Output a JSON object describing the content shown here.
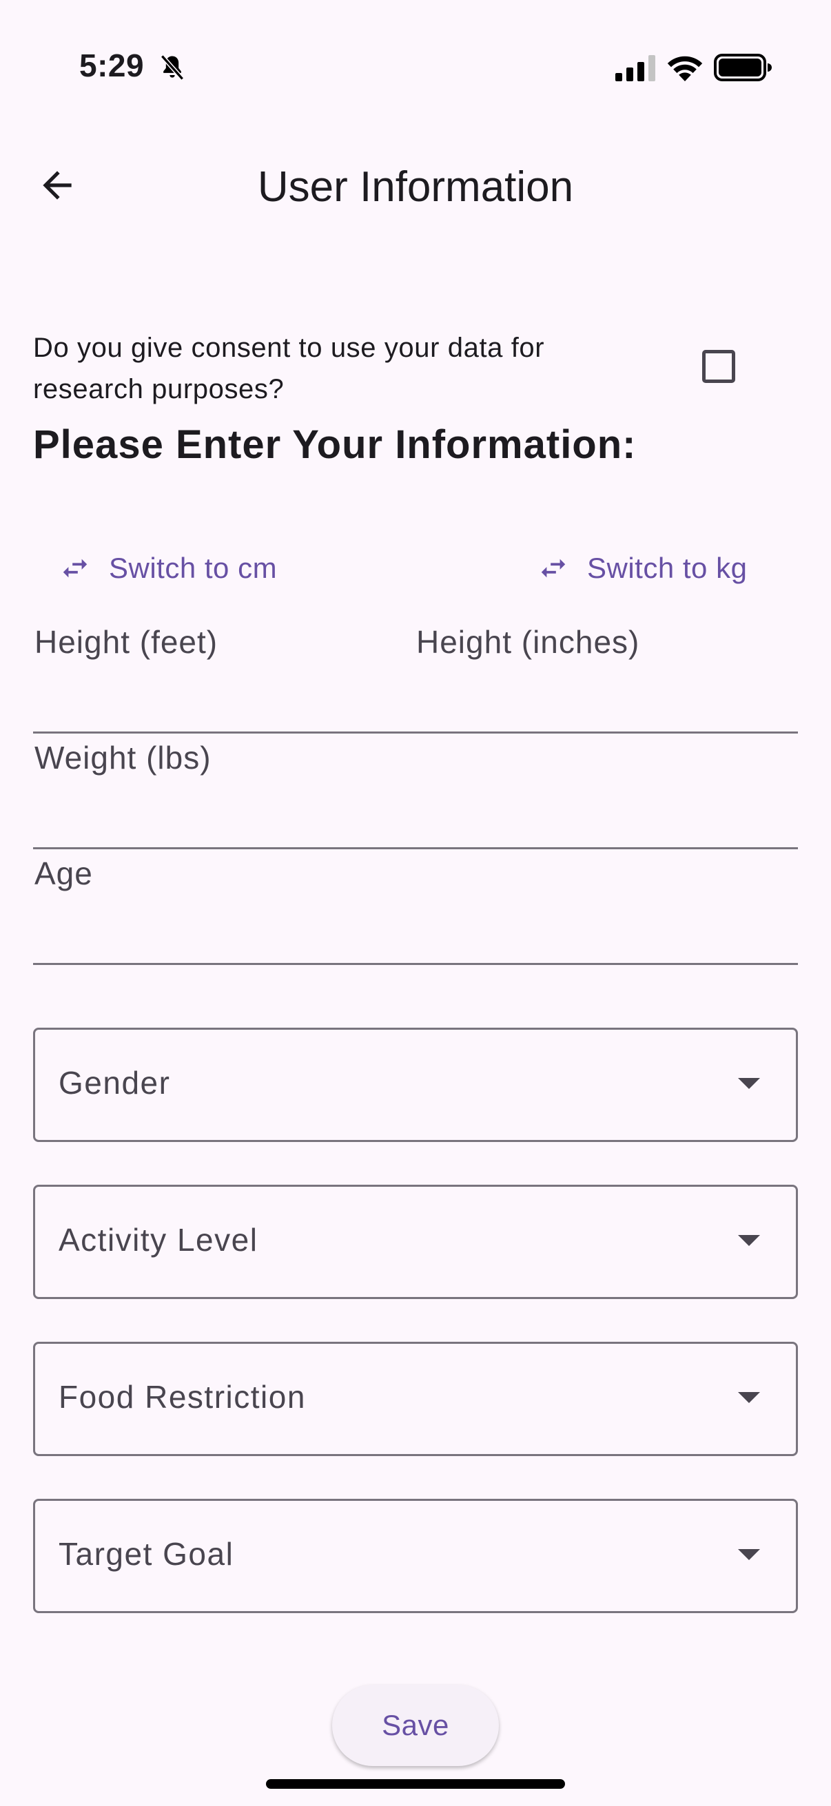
{
  "status_bar": {
    "time": "5:29"
  },
  "app_bar": {
    "title": "User Information"
  },
  "consent": {
    "question": "Do you give consent to use your data for research purposes?",
    "checked": false
  },
  "form": {
    "heading": "Please Enter Your Information:",
    "switch_height_label": "Switch to cm",
    "switch_weight_label": "Switch to kg",
    "height_feet_label": "Height (feet)",
    "height_inches_label": "Height (inches)",
    "weight_label": "Weight (lbs)",
    "age_label": "Age",
    "dropdowns": [
      {
        "label": "Gender"
      },
      {
        "label": "Activity Level"
      },
      {
        "label": "Food Restriction"
      },
      {
        "label": "Target Goal"
      }
    ],
    "save_label": "Save"
  },
  "colors": {
    "accent": "#6750a4",
    "background": "#fdf7fd",
    "outline": "#79747e"
  }
}
